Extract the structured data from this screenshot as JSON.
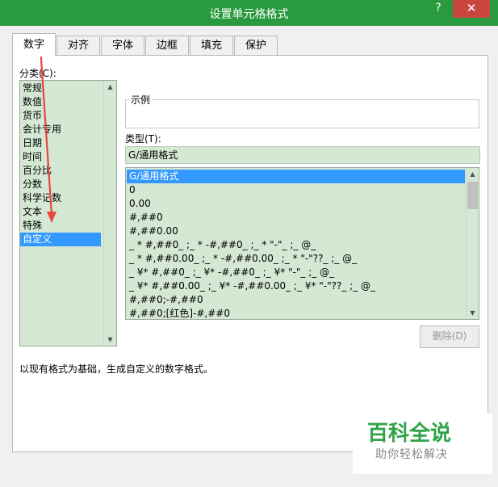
{
  "window": {
    "title": "设置单元格格式",
    "help": "?",
    "close": "✕"
  },
  "tabs": [
    "数字",
    "对齐",
    "字体",
    "边框",
    "填充",
    "保护"
  ],
  "category_label": "分类(C):",
  "categories": [
    "常规",
    "数值",
    "货币",
    "会计专用",
    "日期",
    "时间",
    "百分比",
    "分数",
    "科学记数",
    "文本",
    "特殊",
    "自定义"
  ],
  "selected_category": "自定义",
  "sample_label": "示例",
  "type_label": "类型(T):",
  "type_value": "G/通用格式",
  "formats": [
    "G/通用格式",
    "0",
    "0.00",
    "#,##0",
    "#,##0.00",
    "_ * #,##0_ ;_ * -#,##0_ ;_ * \"-\"_ ;_ @_",
    "_ * #,##0.00_ ;_ * -#,##0.00_ ;_ * \"-\"??_ ;_ @_",
    "_ ¥* #,##0_ ;_ ¥* -#,##0_ ;_ ¥* \"-\"_ ;_ @_",
    "_ ¥* #,##0.00_ ;_ ¥* -#,##0.00_ ;_ ¥* \"-\"??_ ;_ @_",
    "#,##0;-#,##0",
    "#,##0;[红色]-#,##0"
  ],
  "delete_button": "删除(D)",
  "description": "以现有格式为基础，生成自定义的数字格式。",
  "watermark": {
    "title": "百科全说",
    "subtitle": "助你轻松解决"
  },
  "colors": {
    "titlebar": "#2a9a3f",
    "list_bg": "#d4e8d4",
    "selection": "#3399ff",
    "close": "#c9463d",
    "arrow": "#e8453c"
  }
}
